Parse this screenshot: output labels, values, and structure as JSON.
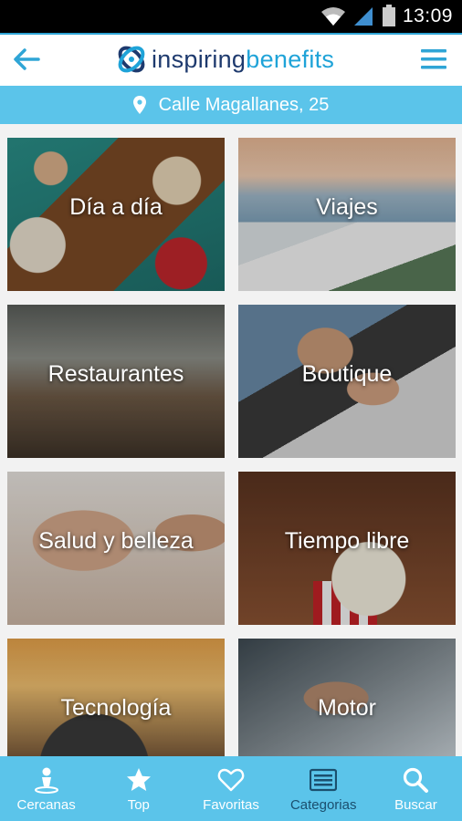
{
  "status_bar": {
    "time": "13:09",
    "icons": [
      "wifi-icon",
      "signal-icon",
      "battery-icon"
    ]
  },
  "header": {
    "brand_part1": "inspiring",
    "brand_part2": "benefits",
    "back_icon": "arrow-left-icon",
    "menu_icon": "hamburger-menu-icon"
  },
  "location": {
    "icon": "location-pin-icon",
    "address": "Calle Magallanes, 25"
  },
  "categories": [
    {
      "label": "Día a día"
    },
    {
      "label": "Viajes"
    },
    {
      "label": "Restaurantes"
    },
    {
      "label": "Boutique"
    },
    {
      "label": "Salud y belleza"
    },
    {
      "label": "Tiempo libre"
    },
    {
      "label": "Tecnología"
    },
    {
      "label": "Motor"
    }
  ],
  "bottom_nav": [
    {
      "label": "Cercanas",
      "icon": "person-pin-icon"
    },
    {
      "label": "Top",
      "icon": "star-icon"
    },
    {
      "label": "Favoritas",
      "icon": "heart-icon"
    },
    {
      "label": "Categorias",
      "icon": "category-list-icon",
      "active": true
    },
    {
      "label": "Buscar",
      "icon": "search-icon"
    }
  ],
  "colors": {
    "accent": "#5bc4ea",
    "brand_dark": "#1e3a6e",
    "brand_light": "#1fa3d8",
    "active_nav": "#1b4f6e"
  }
}
